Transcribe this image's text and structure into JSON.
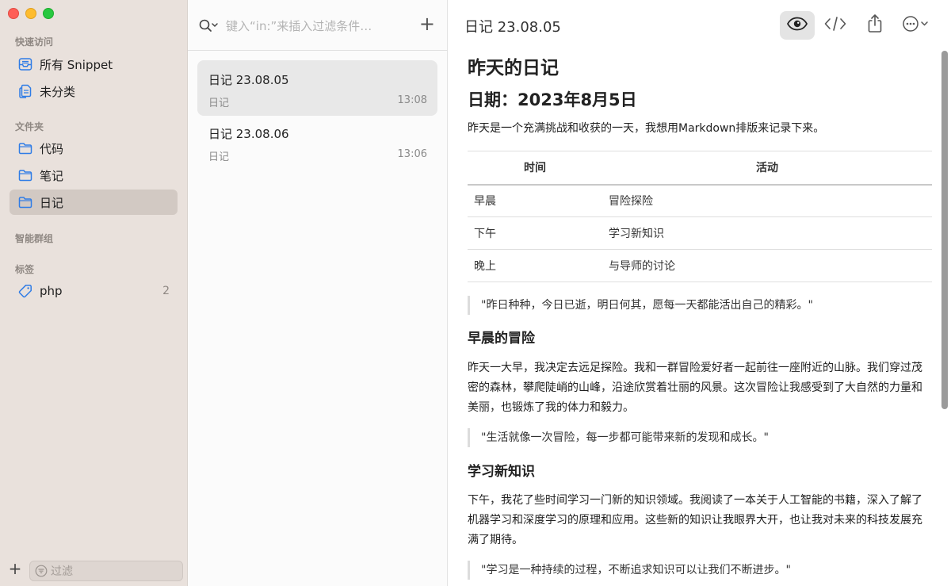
{
  "sidebar": {
    "quick_access_title": "快速访问",
    "quick_access": [
      {
        "label": "所有 Snippet",
        "icon": "tray-icon"
      },
      {
        "label": "未分类",
        "icon": "documents-icon"
      }
    ],
    "folders_title": "文件夹",
    "folders": [
      {
        "label": "代码",
        "icon": "folder-icon"
      },
      {
        "label": "笔记",
        "icon": "folder-icon"
      },
      {
        "label": "日记",
        "icon": "folder-icon",
        "active": true
      }
    ],
    "smart_groups_title": "智能群组",
    "tags_title": "标签",
    "tags": [
      {
        "label": "php",
        "count": "2",
        "icon": "tag-icon"
      }
    ],
    "bottom": {
      "add_label": "+",
      "filter_placeholder": "过滤"
    }
  },
  "list": {
    "search_placeholder": "键入“in:”来插入过滤条件…",
    "add_label": "+",
    "items": [
      {
        "title": "日记 23.08.05",
        "folder": "日记",
        "time": "13:08",
        "active": true
      },
      {
        "title": "日记 23.08.06",
        "folder": "日记",
        "time": "13:06"
      }
    ]
  },
  "detail": {
    "title": "日记 23.08.05",
    "toolbar": [
      "eye-icon",
      "code-icon",
      "share-icon",
      "more-icon"
    ],
    "content": {
      "h1": "昨天的日记",
      "h2": "日期：2023年8月5日",
      "intro": "昨天是一个充满挑战和收获的一天，我想用Markdown排版来记录下来。",
      "table": {
        "headers": [
          "时间",
          "活动"
        ],
        "rows": [
          [
            "早晨",
            "冒险探险"
          ],
          [
            "下午",
            "学习新知识"
          ],
          [
            "晚上",
            "与导师的讨论"
          ]
        ]
      },
      "quote1": "\"昨日种种，今日已逝，明日何其，愿每一天都能活出自己的精彩。\"",
      "section1_title": "早晨的冒险",
      "section1_text": "昨天一大早，我决定去远足探险。我和一群冒险爱好者一起前往一座附近的山脉。我们穿过茂密的森林，攀爬陡峭的山峰，沿途欣赏着壮丽的风景。这次冒险让我感受到了大自然的力量和美丽，也锻炼了我的体力和毅力。",
      "quote2": "\"生活就像一次冒险，每一步都可能带来新的发现和成长。\"",
      "section2_title": "学习新知识",
      "section2_text": "下午，我花了些时间学习一门新的知识领域。我阅读了一本关于人工智能的书籍，深入了解了机器学习和深度学习的原理和应用。这些新的知识让我眼界大开，也让我对未来的科技发展充满了期待。",
      "quote3": "\"学习是一种持续的过程，不断追求知识可以让我们不断进步。\""
    }
  }
}
